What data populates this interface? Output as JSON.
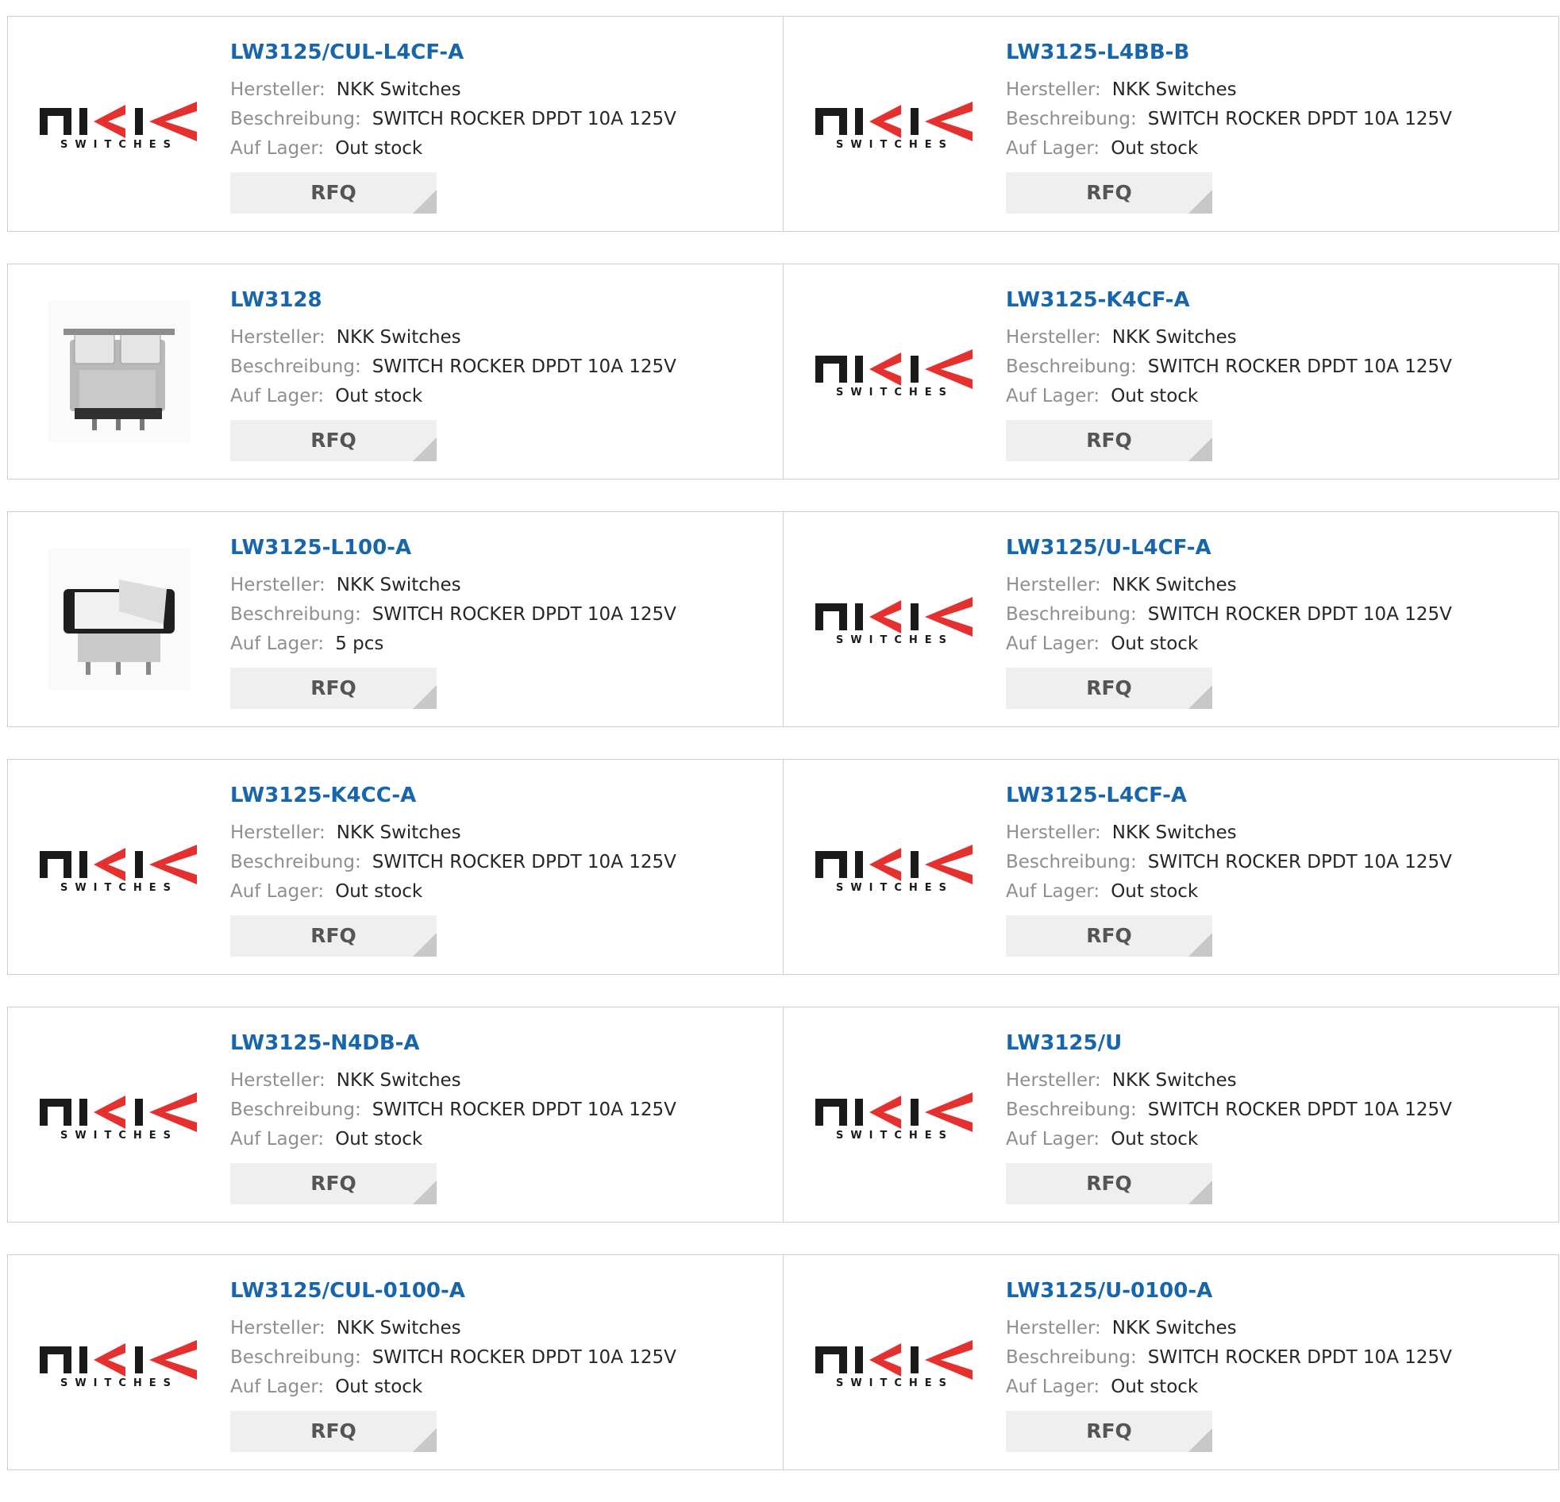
{
  "labels": {
    "manufacturer": "Hersteller:",
    "description": "Beschreibung:",
    "stock": "Auf Lager:",
    "rfq": "RFQ"
  },
  "logo": {
    "top": "nkk",
    "bottom": "SWITCHES",
    "color": "#1a1a1a",
    "accent": "#e53030"
  },
  "colors": {
    "link": "#1766ad",
    "border": "#cfcfcf",
    "button_bg": "#efefef"
  },
  "products": [
    {
      "pn": "LW3125/CUL-L4CF-A",
      "manufacturer": "NKK Switches",
      "description": "SWITCH ROCKER DPDT 10A 125V",
      "stock": "Out stock",
      "image": "nkk-logo"
    },
    {
      "pn": "LW3125-L4BB-B",
      "manufacturer": "NKK Switches",
      "description": "SWITCH ROCKER DPDT 10A 125V",
      "stock": "Out stock",
      "image": "nkk-logo"
    },
    {
      "pn": "LW3128",
      "manufacturer": "NKK Switches",
      "description": "SWITCH ROCKER DPDT 10A 125V",
      "stock": "Out stock",
      "image": "double-rocker-photo"
    },
    {
      "pn": "LW3125-K4CF-A",
      "manufacturer": "NKK Switches",
      "description": "SWITCH ROCKER DPDT 10A 125V",
      "stock": "Out stock",
      "image": "nkk-logo"
    },
    {
      "pn": "LW3125-L100-A",
      "manufacturer": "NKK Switches",
      "description": "SWITCH ROCKER DPDT 10A 125V",
      "stock": "5 pcs",
      "image": "rocker-switch-photo"
    },
    {
      "pn": "LW3125/U-L4CF-A",
      "manufacturer": "NKK Switches",
      "description": "SWITCH ROCKER DPDT 10A 125V",
      "stock": "Out stock",
      "image": "nkk-logo"
    },
    {
      "pn": "LW3125-K4CC-A",
      "manufacturer": "NKK Switches",
      "description": "SWITCH ROCKER DPDT 10A 125V",
      "stock": "Out stock",
      "image": "nkk-logo"
    },
    {
      "pn": "LW3125-L4CF-A",
      "manufacturer": "NKK Switches",
      "description": "SWITCH ROCKER DPDT 10A 125V",
      "stock": "Out stock",
      "image": "nkk-logo"
    },
    {
      "pn": "LW3125-N4DB-A",
      "manufacturer": "NKK Switches",
      "description": "SWITCH ROCKER DPDT 10A 125V",
      "stock": "Out stock",
      "image": "nkk-logo"
    },
    {
      "pn": "LW3125/U",
      "manufacturer": "NKK Switches",
      "description": "SWITCH ROCKER DPDT 10A 125V",
      "stock": "Out stock",
      "image": "nkk-logo"
    },
    {
      "pn": "LW3125/CUL-0100-A",
      "manufacturer": "NKK Switches",
      "description": "SWITCH ROCKER DPDT 10A 125V",
      "stock": "Out stock",
      "image": "nkk-logo"
    },
    {
      "pn": "LW3125/U-0100-A",
      "manufacturer": "NKK Switches",
      "description": "SWITCH ROCKER DPDT 10A 125V",
      "stock": "Out stock",
      "image": "nkk-logo"
    }
  ]
}
